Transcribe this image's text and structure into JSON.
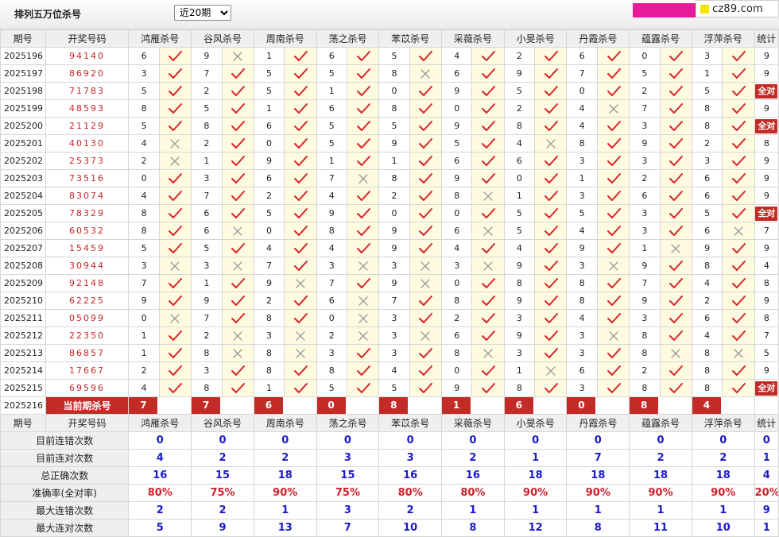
{
  "header": {
    "title": "排列五万位杀号",
    "period_options": [
      "近20期"
    ],
    "period_selected": "近20期",
    "logo_text": "cz89.com"
  },
  "table": {
    "columns": [
      "期号",
      "开奖号码",
      "鸿雁杀号",
      "谷风杀号",
      "周南杀号",
      "荡之杀号",
      "苯苡杀号",
      "采薇杀号",
      "小旻杀号",
      "丹霞杀号",
      "蕴露杀号",
      "浮萍杀号",
      "统计"
    ],
    "rows": [
      {
        "period": "2025196",
        "draw": "94140",
        "kills": [
          {
            "v": "6",
            "ok": true
          },
          {
            "v": "9",
            "ok": false
          },
          {
            "v": "1",
            "ok": true
          },
          {
            "v": "6",
            "ok": true
          },
          {
            "v": "5",
            "ok": true
          },
          {
            "v": "4",
            "ok": true
          },
          {
            "v": "2",
            "ok": true
          },
          {
            "v": "6",
            "ok": true
          },
          {
            "v": "0",
            "ok": true
          },
          {
            "v": "3",
            "ok": true
          }
        ],
        "count": "9"
      },
      {
        "period": "2025197",
        "draw": "86920",
        "kills": [
          {
            "v": "3",
            "ok": true
          },
          {
            "v": "7",
            "ok": true
          },
          {
            "v": "5",
            "ok": true
          },
          {
            "v": "5",
            "ok": true
          },
          {
            "v": "8",
            "ok": false
          },
          {
            "v": "6",
            "ok": true
          },
          {
            "v": "9",
            "ok": true
          },
          {
            "v": "7",
            "ok": true
          },
          {
            "v": "5",
            "ok": true
          },
          {
            "v": "1",
            "ok": true
          }
        ],
        "count": "9"
      },
      {
        "period": "2025198",
        "draw": "71783",
        "kills": [
          {
            "v": "5",
            "ok": true
          },
          {
            "v": "2",
            "ok": true
          },
          {
            "v": "5",
            "ok": true
          },
          {
            "v": "1",
            "ok": true
          },
          {
            "v": "0",
            "ok": true
          },
          {
            "v": "9",
            "ok": true
          },
          {
            "v": "5",
            "ok": true
          },
          {
            "v": "0",
            "ok": true
          },
          {
            "v": "2",
            "ok": true
          },
          {
            "v": "5",
            "ok": true
          }
        ],
        "count": "全对"
      },
      {
        "period": "2025199",
        "draw": "48593",
        "kills": [
          {
            "v": "8",
            "ok": true
          },
          {
            "v": "5",
            "ok": true
          },
          {
            "v": "1",
            "ok": true
          },
          {
            "v": "6",
            "ok": true
          },
          {
            "v": "8",
            "ok": true
          },
          {
            "v": "0",
            "ok": true
          },
          {
            "v": "2",
            "ok": true
          },
          {
            "v": "4",
            "ok": false
          },
          {
            "v": "7",
            "ok": true
          },
          {
            "v": "8",
            "ok": true
          }
        ],
        "count": "9"
      },
      {
        "period": "2025200",
        "draw": "21129",
        "kills": [
          {
            "v": "5",
            "ok": true
          },
          {
            "v": "8",
            "ok": true
          },
          {
            "v": "6",
            "ok": true
          },
          {
            "v": "5",
            "ok": true
          },
          {
            "v": "5",
            "ok": true
          },
          {
            "v": "9",
            "ok": true
          },
          {
            "v": "8",
            "ok": true
          },
          {
            "v": "4",
            "ok": true
          },
          {
            "v": "3",
            "ok": true
          },
          {
            "v": "8",
            "ok": true
          }
        ],
        "count": "全对"
      },
      {
        "period": "2025201",
        "draw": "40130",
        "kills": [
          {
            "v": "4",
            "ok": false
          },
          {
            "v": "2",
            "ok": true
          },
          {
            "v": "0",
            "ok": true
          },
          {
            "v": "5",
            "ok": true
          },
          {
            "v": "9",
            "ok": true
          },
          {
            "v": "5",
            "ok": true
          },
          {
            "v": "4",
            "ok": false
          },
          {
            "v": "8",
            "ok": true
          },
          {
            "v": "9",
            "ok": true
          },
          {
            "v": "2",
            "ok": true
          }
        ],
        "count": "8"
      },
      {
        "period": "2025202",
        "draw": "25373",
        "kills": [
          {
            "v": "2",
            "ok": false
          },
          {
            "v": "1",
            "ok": true
          },
          {
            "v": "9",
            "ok": true
          },
          {
            "v": "1",
            "ok": true
          },
          {
            "v": "1",
            "ok": true
          },
          {
            "v": "6",
            "ok": true
          },
          {
            "v": "6",
            "ok": true
          },
          {
            "v": "3",
            "ok": true
          },
          {
            "v": "3",
            "ok": true
          },
          {
            "v": "3",
            "ok": true
          }
        ],
        "count": "9"
      },
      {
        "period": "2025203",
        "draw": "73516",
        "kills": [
          {
            "v": "0",
            "ok": true
          },
          {
            "v": "3",
            "ok": true
          },
          {
            "v": "6",
            "ok": true
          },
          {
            "v": "7",
            "ok": false
          },
          {
            "v": "8",
            "ok": true
          },
          {
            "v": "9",
            "ok": true
          },
          {
            "v": "0",
            "ok": true
          },
          {
            "v": "1",
            "ok": true
          },
          {
            "v": "2",
            "ok": true
          },
          {
            "v": "6",
            "ok": true
          }
        ],
        "count": "9"
      },
      {
        "period": "2025204",
        "draw": "83074",
        "kills": [
          {
            "v": "4",
            "ok": true
          },
          {
            "v": "7",
            "ok": true
          },
          {
            "v": "2",
            "ok": true
          },
          {
            "v": "4",
            "ok": true
          },
          {
            "v": "2",
            "ok": true
          },
          {
            "v": "8",
            "ok": false
          },
          {
            "v": "1",
            "ok": true
          },
          {
            "v": "3",
            "ok": true
          },
          {
            "v": "6",
            "ok": true
          },
          {
            "v": "6",
            "ok": true
          }
        ],
        "count": "9"
      },
      {
        "period": "2025205",
        "draw": "78329",
        "kills": [
          {
            "v": "8",
            "ok": true
          },
          {
            "v": "6",
            "ok": true
          },
          {
            "v": "5",
            "ok": true
          },
          {
            "v": "9",
            "ok": true
          },
          {
            "v": "0",
            "ok": true
          },
          {
            "v": "0",
            "ok": true
          },
          {
            "v": "5",
            "ok": true
          },
          {
            "v": "5",
            "ok": true
          },
          {
            "v": "3",
            "ok": true
          },
          {
            "v": "5",
            "ok": true
          }
        ],
        "count": "全对"
      },
      {
        "period": "2025206",
        "draw": "60532",
        "kills": [
          {
            "v": "8",
            "ok": true
          },
          {
            "v": "6",
            "ok": false
          },
          {
            "v": "0",
            "ok": true
          },
          {
            "v": "8",
            "ok": true
          },
          {
            "v": "9",
            "ok": true
          },
          {
            "v": "6",
            "ok": false
          },
          {
            "v": "5",
            "ok": true
          },
          {
            "v": "4",
            "ok": true
          },
          {
            "v": "3",
            "ok": true
          },
          {
            "v": "6",
            "ok": false
          }
        ],
        "count": "7"
      },
      {
        "period": "2025207",
        "draw": "15459",
        "kills": [
          {
            "v": "5",
            "ok": true
          },
          {
            "v": "5",
            "ok": true
          },
          {
            "v": "4",
            "ok": true
          },
          {
            "v": "4",
            "ok": true
          },
          {
            "v": "9",
            "ok": true
          },
          {
            "v": "4",
            "ok": true
          },
          {
            "v": "4",
            "ok": true
          },
          {
            "v": "9",
            "ok": true
          },
          {
            "v": "1",
            "ok": false
          },
          {
            "v": "9",
            "ok": true
          }
        ],
        "count": "9"
      },
      {
        "period": "2025208",
        "draw": "30944",
        "kills": [
          {
            "v": "3",
            "ok": false
          },
          {
            "v": "3",
            "ok": false
          },
          {
            "v": "7",
            "ok": true
          },
          {
            "v": "3",
            "ok": false
          },
          {
            "v": "3",
            "ok": false
          },
          {
            "v": "3",
            "ok": false
          },
          {
            "v": "9",
            "ok": true
          },
          {
            "v": "3",
            "ok": false
          },
          {
            "v": "9",
            "ok": true
          },
          {
            "v": "8",
            "ok": true
          }
        ],
        "count": "4"
      },
      {
        "period": "2025209",
        "draw": "92148",
        "kills": [
          {
            "v": "7",
            "ok": true
          },
          {
            "v": "1",
            "ok": true
          },
          {
            "v": "9",
            "ok": false
          },
          {
            "v": "7",
            "ok": true
          },
          {
            "v": "9",
            "ok": false
          },
          {
            "v": "0",
            "ok": true
          },
          {
            "v": "8",
            "ok": true
          },
          {
            "v": "8",
            "ok": true
          },
          {
            "v": "7",
            "ok": true
          },
          {
            "v": "4",
            "ok": true
          }
        ],
        "count": "8"
      },
      {
        "period": "2025210",
        "draw": "62225",
        "kills": [
          {
            "v": "9",
            "ok": true
          },
          {
            "v": "9",
            "ok": true
          },
          {
            "v": "2",
            "ok": true
          },
          {
            "v": "6",
            "ok": false
          },
          {
            "v": "7",
            "ok": true
          },
          {
            "v": "8",
            "ok": true
          },
          {
            "v": "9",
            "ok": true
          },
          {
            "v": "8",
            "ok": true
          },
          {
            "v": "9",
            "ok": true
          },
          {
            "v": "2",
            "ok": true
          }
        ],
        "count": "9"
      },
      {
        "period": "2025211",
        "draw": "05099",
        "kills": [
          {
            "v": "0",
            "ok": false
          },
          {
            "v": "7",
            "ok": true
          },
          {
            "v": "8",
            "ok": true
          },
          {
            "v": "0",
            "ok": false
          },
          {
            "v": "3",
            "ok": true
          },
          {
            "v": "2",
            "ok": true
          },
          {
            "v": "3",
            "ok": true
          },
          {
            "v": "4",
            "ok": true
          },
          {
            "v": "3",
            "ok": true
          },
          {
            "v": "6",
            "ok": true
          }
        ],
        "count": "8"
      },
      {
        "period": "2025212",
        "draw": "22350",
        "kills": [
          {
            "v": "1",
            "ok": true
          },
          {
            "v": "2",
            "ok": false
          },
          {
            "v": "3",
            "ok": false
          },
          {
            "v": "2",
            "ok": false
          },
          {
            "v": "3",
            "ok": false
          },
          {
            "v": "6",
            "ok": true
          },
          {
            "v": "9",
            "ok": true
          },
          {
            "v": "3",
            "ok": false
          },
          {
            "v": "8",
            "ok": true
          },
          {
            "v": "4",
            "ok": true
          }
        ],
        "count": "7"
      },
      {
        "period": "2025213",
        "draw": "86857",
        "kills": [
          {
            "v": "1",
            "ok": true
          },
          {
            "v": "8",
            "ok": false
          },
          {
            "v": "8",
            "ok": false
          },
          {
            "v": "3",
            "ok": true
          },
          {
            "v": "3",
            "ok": true
          },
          {
            "v": "8",
            "ok": false
          },
          {
            "v": "3",
            "ok": true
          },
          {
            "v": "3",
            "ok": true
          },
          {
            "v": "8",
            "ok": false
          },
          {
            "v": "8",
            "ok": false
          }
        ],
        "count": "5"
      },
      {
        "period": "2025214",
        "draw": "17667",
        "kills": [
          {
            "v": "2",
            "ok": true
          },
          {
            "v": "3",
            "ok": true
          },
          {
            "v": "8",
            "ok": true
          },
          {
            "v": "8",
            "ok": true
          },
          {
            "v": "4",
            "ok": true
          },
          {
            "v": "0",
            "ok": true
          },
          {
            "v": "1",
            "ok": false
          },
          {
            "v": "6",
            "ok": true
          },
          {
            "v": "2",
            "ok": true
          },
          {
            "v": "8",
            "ok": true
          }
        ],
        "count": "9"
      },
      {
        "period": "2025215",
        "draw": "69596",
        "kills": [
          {
            "v": "4",
            "ok": true
          },
          {
            "v": "8",
            "ok": true
          },
          {
            "v": "1",
            "ok": true
          },
          {
            "v": "5",
            "ok": true
          },
          {
            "v": "5",
            "ok": true
          },
          {
            "v": "9",
            "ok": true
          },
          {
            "v": "8",
            "ok": true
          },
          {
            "v": "3",
            "ok": true
          },
          {
            "v": "8",
            "ok": true
          },
          {
            "v": "8",
            "ok": true
          }
        ],
        "count": "全对"
      }
    ],
    "current": {
      "period": "2025216",
      "label": "当前期杀号",
      "kills": [
        "7",
        "7",
        "6",
        "0",
        "8",
        "1",
        "6",
        "0",
        "8",
        "4"
      ]
    },
    "stats": [
      {
        "label": "目前连错次数",
        "values": [
          "0",
          "0",
          "0",
          "0",
          "0",
          "0",
          "0",
          "0",
          "0",
          "0"
        ],
        "total": "0",
        "red": false
      },
      {
        "label": "目前连对次数",
        "values": [
          "4",
          "2",
          "2",
          "3",
          "3",
          "2",
          "1",
          "7",
          "2",
          "2"
        ],
        "total": "1",
        "red": false
      },
      {
        "label": "总正确次数",
        "values": [
          "16",
          "15",
          "18",
          "15",
          "16",
          "16",
          "18",
          "18",
          "18",
          "18"
        ],
        "total": "4",
        "red": false
      },
      {
        "label": "准确率(全对率)",
        "values": [
          "80%",
          "75%",
          "90%",
          "75%",
          "80%",
          "80%",
          "90%",
          "90%",
          "90%",
          "90%"
        ],
        "total": "20%",
        "red": true
      },
      {
        "label": "最大连错次数",
        "values": [
          "2",
          "2",
          "1",
          "3",
          "2",
          "1",
          "1",
          "1",
          "1",
          "1"
        ],
        "total": "9",
        "red": false
      },
      {
        "label": "最大连对次数",
        "values": [
          "5",
          "9",
          "13",
          "7",
          "10",
          "8",
          "12",
          "8",
          "11",
          "10"
        ],
        "total": "1",
        "red": false
      }
    ]
  },
  "icons": {
    "correct": "check-icon",
    "wrong": "cross-icon"
  },
  "colors": {
    "check": "#d8232a",
    "cross": "#9a9a9a",
    "badge": "#c32b26",
    "stat_blue": "#1a1acd",
    "stat_red": "#d0202a",
    "cell_highlight": "#fffbe0"
  }
}
